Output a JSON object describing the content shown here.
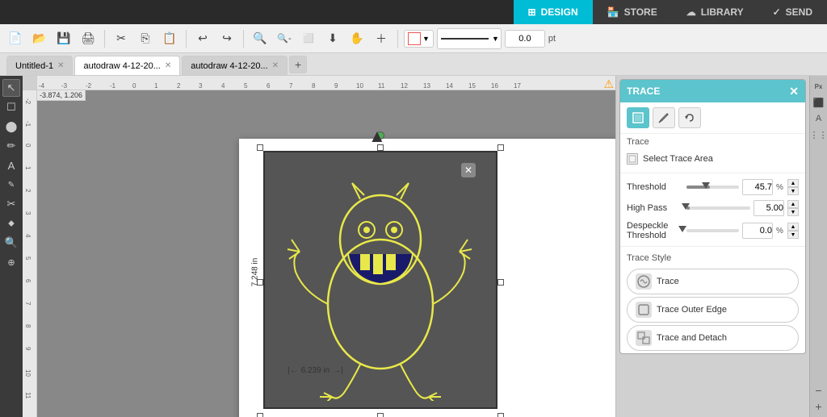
{
  "topnav": {
    "tabs": [
      {
        "id": "design",
        "label": "DESIGN",
        "icon": "⊞",
        "active": true
      },
      {
        "id": "store",
        "label": "STORE",
        "icon": "🏪",
        "active": false
      },
      {
        "id": "library",
        "label": "LIBRARY",
        "icon": "☁",
        "active": false
      },
      {
        "id": "send",
        "label": "SEND",
        "icon": "✓",
        "active": false
      }
    ]
  },
  "toolbar": {
    "tools": [
      "↩",
      "↪",
      "✂",
      "⎘",
      "⎙",
      "🔍+",
      "🔍-",
      "🔍□",
      "⬇",
      "✋",
      "＋"
    ],
    "shape_label": "□",
    "line_width": "0.0",
    "unit": "pt"
  },
  "doc_tabs": [
    {
      "id": "untitled",
      "label": "Untitled-1",
      "active": false
    },
    {
      "id": "autodraw1",
      "label": "autodraw 4-12-20...",
      "active": true
    },
    {
      "id": "autodraw2",
      "label": "autodraw 4-12-20...",
      "active": false
    }
  ],
  "canvas": {
    "coord_display": "-3.874, 1.206",
    "ruler_labels": [
      "-4",
      "-3",
      "-2",
      "-1",
      "0",
      "1",
      "2",
      "3",
      "4",
      "5",
      "6",
      "7",
      "8",
      "9",
      "10",
      "11",
      "12",
      "13",
      "14",
      "15",
      "16",
      "17"
    ],
    "dimension_v": "7.248 in",
    "dimension_h": "6.239 in",
    "warning_icon": "⚠"
  },
  "trace_panel": {
    "title": "TRACE",
    "close_btn": "✕",
    "toolbar_tools": [
      {
        "id": "trace-select",
        "icon": "⬛",
        "active": true
      },
      {
        "id": "trace-edit",
        "icon": "✏"
      },
      {
        "id": "trace-undo",
        "icon": "↩"
      }
    ],
    "section_trace": "Trace",
    "select_area_label": "Select Trace Area",
    "threshold_label": "Threshold",
    "threshold_value": "45.7",
    "threshold_unit": "%",
    "threshold_fill_pct": 45,
    "high_pass_label": "High Pass",
    "high_pass_value": "5.00",
    "despeckle_label": "Despeckle",
    "threshold2_label": "Threshold",
    "despeckle_value": "0.0",
    "despeckle_unit": "%",
    "despeckle_fill_pct": 0,
    "trace_style_label": "Trace Style",
    "trace_btn_label": "Trace",
    "trace_outer_label": "Trace Outer Edge",
    "trace_detach_label": "Trace and Detach"
  },
  "left_tools": [
    "↖",
    "☐",
    "⬤",
    "✏",
    "A",
    "📝",
    "✂",
    "🪣",
    "🔍",
    "⚙"
  ],
  "right_side_icons": [
    "Px",
    "⬛",
    "A",
    "⋮"
  ]
}
